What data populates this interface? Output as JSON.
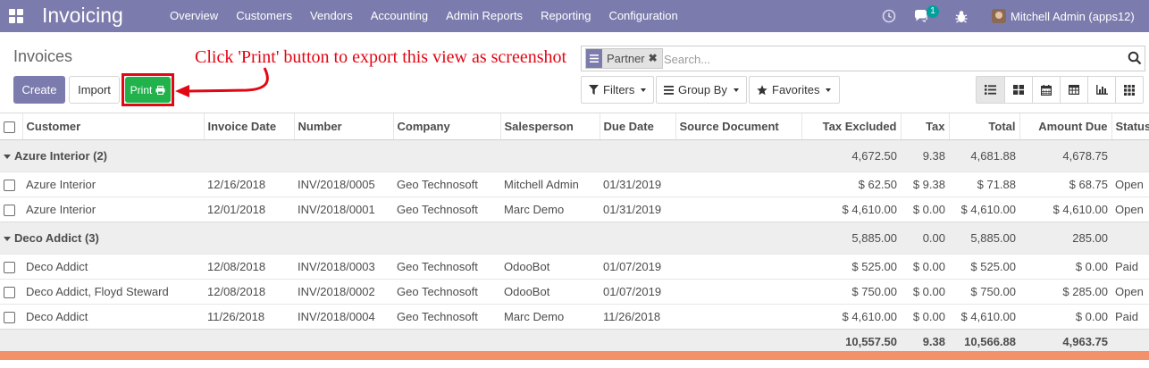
{
  "navbar": {
    "app_title": "Invoicing",
    "menu": [
      "Overview",
      "Customers",
      "Vendors",
      "Accounting",
      "Admin Reports",
      "Reporting",
      "Configuration"
    ],
    "chat_count": "1",
    "user": "Mitchell Admin (apps12)",
    "icons": [
      "apps-grid-icon",
      "clock-icon",
      "chat-icon",
      "bug-icon",
      "avatar"
    ]
  },
  "control_panel": {
    "breadcrumb": "Invoices",
    "create_label": "Create",
    "import_label": "Import",
    "print_label": "Print",
    "annotation": "Click 'Print' button to export this view as screenshot",
    "search": {
      "facet_label": "Partner",
      "placeholder": "Search..."
    },
    "filters_label": "Filters",
    "groupby_label": "Group By",
    "favorites_label": "Favorites",
    "views": [
      "list",
      "kanban",
      "calendar",
      "pivot",
      "graph",
      "grid"
    ],
    "active_view": "list"
  },
  "table": {
    "columns": [
      "Customer",
      "Invoice Date",
      "Number",
      "Company",
      "Salesperson",
      "Due Date",
      "Source Document",
      "Tax Excluded",
      "Tax",
      "Total",
      "Amount Due",
      "Status"
    ],
    "groups": [
      {
        "label": "Azure Interior (2)",
        "tax_excluded": "4,672.50",
        "tax": "9.38",
        "total": "4,681.88",
        "amount_due": "4,678.75",
        "rows": [
          {
            "customer": "Azure Interior",
            "invoice_date": "12/16/2018",
            "number": "INV/2018/0005",
            "company": "Geo Technosoft",
            "salesperson": "Mitchell Admin",
            "due_date": "01/31/2019",
            "source_document": "",
            "tax_excluded": "$ 62.50",
            "tax": "$ 9.38",
            "total": "$ 71.88",
            "amount_due": "$ 68.75",
            "status": "Open"
          },
          {
            "customer": "Azure Interior",
            "invoice_date": "12/01/2018",
            "number": "INV/2018/0001",
            "company": "Geo Technosoft",
            "salesperson": "Marc Demo",
            "due_date": "01/31/2019",
            "source_document": "",
            "tax_excluded": "$ 4,610.00",
            "tax": "$ 0.00",
            "total": "$ 4,610.00",
            "amount_due": "$ 4,610.00",
            "status": "Open"
          }
        ]
      },
      {
        "label": "Deco Addict (3)",
        "tax_excluded": "5,885.00",
        "tax": "0.00",
        "total": "5,885.00",
        "amount_due": "285.00",
        "rows": [
          {
            "customer": "Deco Addict",
            "invoice_date": "12/08/2018",
            "number": "INV/2018/0003",
            "company": "Geo Technosoft",
            "salesperson": "OdooBot",
            "due_date": "01/07/2019",
            "source_document": "",
            "tax_excluded": "$ 525.00",
            "tax": "$ 0.00",
            "total": "$ 525.00",
            "amount_due": "$ 0.00",
            "status": "Paid"
          },
          {
            "customer": "Deco Addict, Floyd Steward",
            "invoice_date": "12/08/2018",
            "number": "INV/2018/0002",
            "company": "Geo Technosoft",
            "salesperson": "OdooBot",
            "due_date": "01/07/2019",
            "source_document": "",
            "tax_excluded": "$ 750.00",
            "tax": "$ 0.00",
            "total": "$ 750.00",
            "amount_due": "$ 285.00",
            "status": "Open"
          },
          {
            "customer": "Deco Addict",
            "invoice_date": "11/26/2018",
            "number": "INV/2018/0004",
            "company": "Geo Technosoft",
            "salesperson": "Marc Demo",
            "due_date": "11/26/2018",
            "source_document": "",
            "tax_excluded": "$ 4,610.00",
            "tax": "$ 0.00",
            "total": "$ 4,610.00",
            "amount_due": "$ 0.00",
            "status": "Paid"
          }
        ]
      }
    ],
    "totals": {
      "tax_excluded": "10,557.50",
      "tax": "9.38",
      "total": "10,566.88",
      "amount_due": "4,963.75"
    }
  },
  "colors": {
    "navbar": "#7c7bad",
    "primary": "#7c7bad",
    "print_button": "#21b24b",
    "annotation": "#e30613",
    "bottom_strip": "#f2916a"
  }
}
